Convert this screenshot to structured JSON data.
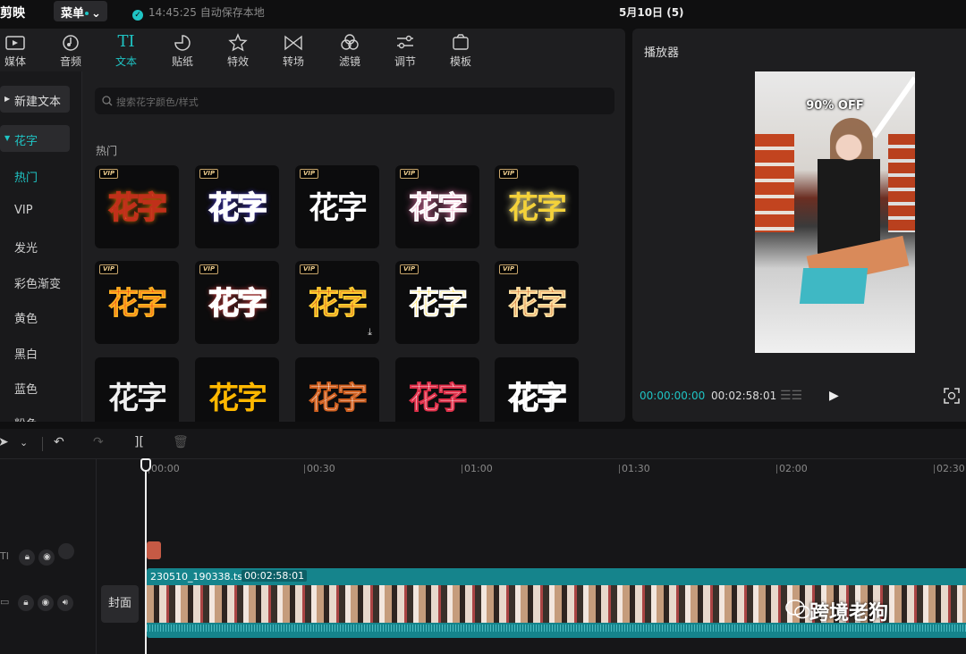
{
  "app": {
    "name": "剪映",
    "menu_label": "菜单",
    "autosave": "14:45:25 自动保存本地",
    "project_title": "5月10日 (5)"
  },
  "toolbar": {
    "items": [
      {
        "label": "媒体",
        "icon": "media-icon"
      },
      {
        "label": "音频",
        "icon": "audio-icon"
      },
      {
        "label": "文本",
        "icon": "text-icon",
        "active": true
      },
      {
        "label": "贴纸",
        "icon": "sticker-icon"
      },
      {
        "label": "特效",
        "icon": "effects-icon"
      },
      {
        "label": "转场",
        "icon": "transition-icon"
      },
      {
        "label": "滤镜",
        "icon": "filter-icon"
      },
      {
        "label": "调节",
        "icon": "adjust-icon"
      },
      {
        "label": "模板",
        "icon": "template-icon"
      }
    ]
  },
  "sidebar": {
    "new_text": "新建文本",
    "huazi": "花字",
    "items": [
      "热门",
      "VIP",
      "发光",
      "彩色渐变",
      "黄色",
      "黑白",
      "蓝色",
      "粉色"
    ]
  },
  "search": {
    "placeholder": "搜索花字颜色/样式"
  },
  "section": {
    "title": "热门"
  },
  "tiles": {
    "vip_label": "VIP",
    "text": "花字"
  },
  "player": {
    "title": "播放器",
    "current": "00:00:00:00",
    "total": "00:02:58:01",
    "overlay_text": "90% OFF"
  },
  "timeline": {
    "ticks": [
      "00:00",
      "00:30",
      "01:00",
      "01:30",
      "02:00",
      "02:30"
    ],
    "cover_label": "封面",
    "clip_name": "230510_190338.ts",
    "clip_duration": "00:02:58:01"
  },
  "watermark": {
    "text": "跨境老狗"
  },
  "colors": {
    "accent": "#1fc4c4",
    "panel": "#1e1e20",
    "clip": "#15848c",
    "text_clip": "#c55a45"
  }
}
